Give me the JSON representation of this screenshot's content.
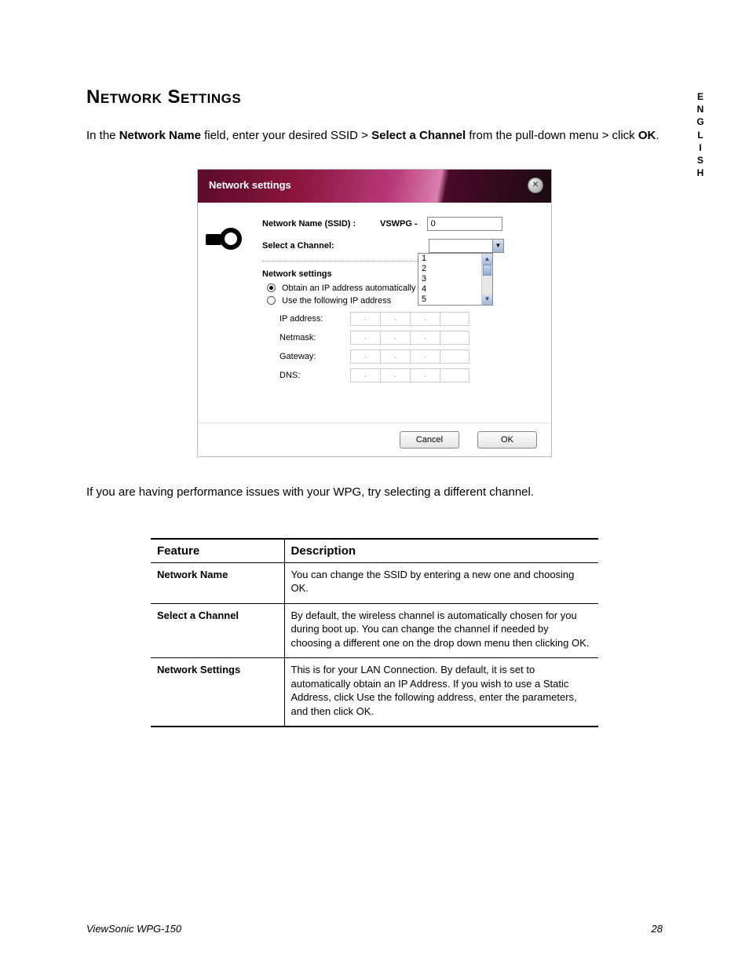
{
  "lang_tag": [
    "E",
    "N",
    "G",
    "L",
    "I",
    "S",
    "H"
  ],
  "heading": "Network Settings",
  "intro": {
    "pre": "In the ",
    "b1": "Network Name",
    "mid1": " field, enter your desired SSID > ",
    "b2": "Select a Channel",
    "mid2": " from the pull-down menu > click ",
    "b3": "OK",
    "post": "."
  },
  "dialog": {
    "title": "Network settings",
    "ssid_label": "Network Name (SSID) :",
    "ssid_prefix": "VSWPG -",
    "ssid_value": "0",
    "channel_label": "Select a Channel:",
    "dropdown_options": [
      "1",
      "2",
      "3",
      "4",
      "5"
    ],
    "section_title": "Network settings",
    "radio_auto": "Obtain an IP address automatically",
    "radio_manual": "Use the following IP address",
    "ip_rows": [
      "IP address:",
      "Netmask:",
      "Gateway:",
      "DNS:"
    ],
    "cancel": "Cancel",
    "ok": "OK"
  },
  "post_note": "If you are having performance issues with your WPG, try selecting a different channel.",
  "table": {
    "col1": "Feature",
    "col2": "Description",
    "rows": [
      {
        "f": "Network Name",
        "d": "You can change the SSID by entering a new one and choosing OK."
      },
      {
        "f": "Select a Channel",
        "d": "By default, the wireless channel is automatically chosen for you during boot up. You can change the channel if needed by choosing a different one on the drop down menu then clicking OK."
      },
      {
        "f": "Network Settings",
        "d": "This is for your LAN Connection. By default, it is set to automatically obtain an IP Address. If you wish to use a Static Address, click Use the following address, enter the parameters, and then click OK."
      }
    ]
  },
  "footer": {
    "product": "ViewSonic WPG-150",
    "page": "28"
  }
}
